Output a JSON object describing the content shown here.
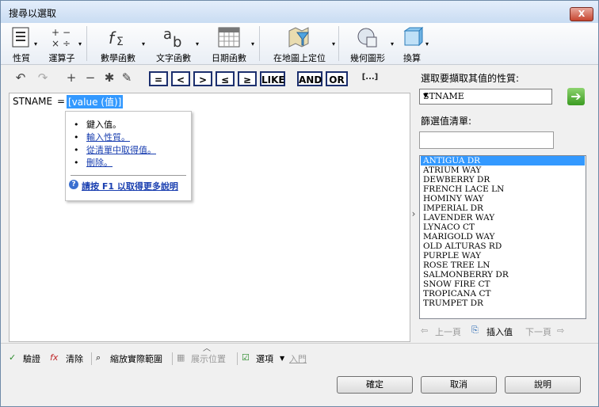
{
  "window": {
    "title": "搜尋以選取",
    "close_label": "X"
  },
  "ribbon": {
    "groups": [
      {
        "label": "性質"
      },
      {
        "label": "運算子"
      },
      {
        "label": "數學函數"
      },
      {
        "label": "文字函數"
      },
      {
        "label": "日期函數"
      },
      {
        "label": "在地圖上定位"
      },
      {
        "label": "幾何圖形"
      },
      {
        "label": "換算"
      }
    ]
  },
  "toolbar": {
    "operators": [
      "=",
      "<",
      ">",
      "≤",
      "≥",
      "LIKE",
      "AND",
      "OR",
      "[...]"
    ]
  },
  "editor": {
    "field_name": "STNAME",
    "operator": "=",
    "selected_value": "[value (值)]"
  },
  "popup": {
    "items": [
      "鍵入值。",
      "輸入性質。",
      "從清單中取得值。",
      "刪除。"
    ],
    "help_text": "請按 F1 以取得更多說明"
  },
  "right_panel": {
    "property_label": "選取要擷取其值的性質:",
    "property_value": "STNAME",
    "filter_label": "篩選值清單:",
    "filter_value": "",
    "values": [
      "ANTIGUA DR",
      "ATRIUM WAY",
      "DEWBERRY DR",
      "FRENCH LACE LN",
      "HOMINY WAY",
      "IMPERIAL DR",
      "LAVENDER WAY",
      "LYNACO CT",
      "MARIGOLD WAY",
      "OLD ALTURAS RD",
      "PURPLE WAY",
      "ROSE TREE LN",
      "SALMONBERRY DR",
      "SNOW FIRE CT",
      "TROPICANA CT",
      "TRUMPET DR"
    ],
    "selected_index": 0,
    "prev_page": "上一頁",
    "insert_value": "插入值",
    "next_page": "下一頁"
  },
  "bottom": {
    "verify": "驗證",
    "clear": "清除",
    "zoom_extent": "縮放實際範圍",
    "show_location": "展示位置",
    "options": "選項",
    "intro": "入門"
  },
  "buttons": {
    "ok": "確定",
    "cancel": "取消",
    "help": "說明"
  }
}
